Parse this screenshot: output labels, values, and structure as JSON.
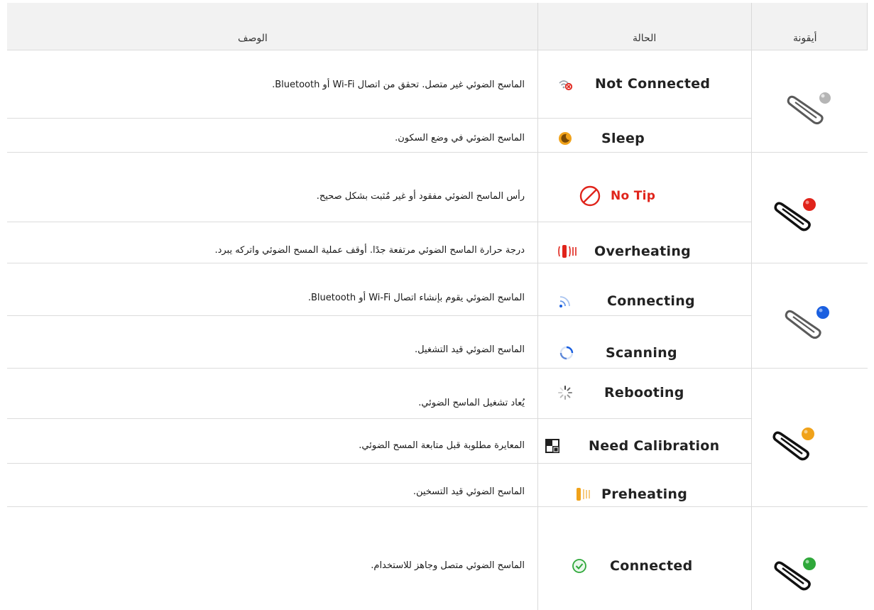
{
  "header": {
    "description": "الوصف",
    "status": "الحالة",
    "icon": "أيقونة"
  },
  "rows": [
    {
      "description": "الماسح الضوئي غير متصل. تحقق من اتصال Wi-Fi أو Bluetooth.",
      "status": "Not Connected",
      "icon": "wifi-off-icon"
    },
    {
      "description": "الماسح الضوئي في وضع السكون.",
      "status": "Sleep",
      "icon": "moon-icon"
    },
    {
      "description": "رأس الماسح الضوئي مفقود أو غير مُثبت بشكل صحيح.",
      "status": "No Tip",
      "icon": "prohibited-icon"
    },
    {
      "description": "درجة حرارة الماسح الضوئي مرتفعة جدًا. أوقف عملية المسح الضوئي واتركه يبرد.",
      "status": "Overheating",
      "icon": "heat-icon"
    },
    {
      "description": "الماسح الضوئي يقوم بإنشاء اتصال Wi-Fi أو Bluetooth.",
      "status": "Connecting",
      "icon": "signal-icon"
    },
    {
      "description": "الماسح الضوئي قيد التشغيل.",
      "status": "Scanning",
      "icon": "spinner-ring-icon"
    },
    {
      "description": "يُعاد تشغيل الماسح الضوئي.",
      "status": "Rebooting",
      "icon": "loading-icon"
    },
    {
      "description": "المعايرة مطلوبة قبل متابعة المسح الضوئي.",
      "status": "Need Calibration",
      "icon": "calibration-icon"
    },
    {
      "description": "الماسح الضوئي قيد التسخين.",
      "status": "Preheating",
      "icon": "warm-icon"
    },
    {
      "description": "الماسح الضوئي متصل وجاهز للاستخدام.",
      "status": "Connected",
      "icon": "check-circle-icon"
    }
  ],
  "scanner_icons": [
    {
      "name": "scanner-gray-icon",
      "color": "#b5b5b5"
    },
    {
      "name": "scanner-red-icon",
      "color": "#e0241b"
    },
    {
      "name": "scanner-blue-icon",
      "color": "#1a5fe0"
    },
    {
      "name": "scanner-orange-icon",
      "color": "#f0a21a"
    },
    {
      "name": "scanner-green-icon",
      "color": "#2fa83a"
    }
  ],
  "colors": {
    "no_tip_text": "#e0241b",
    "header_bg": "#f2f2f2",
    "grid_line": "#d9d9d9"
  }
}
